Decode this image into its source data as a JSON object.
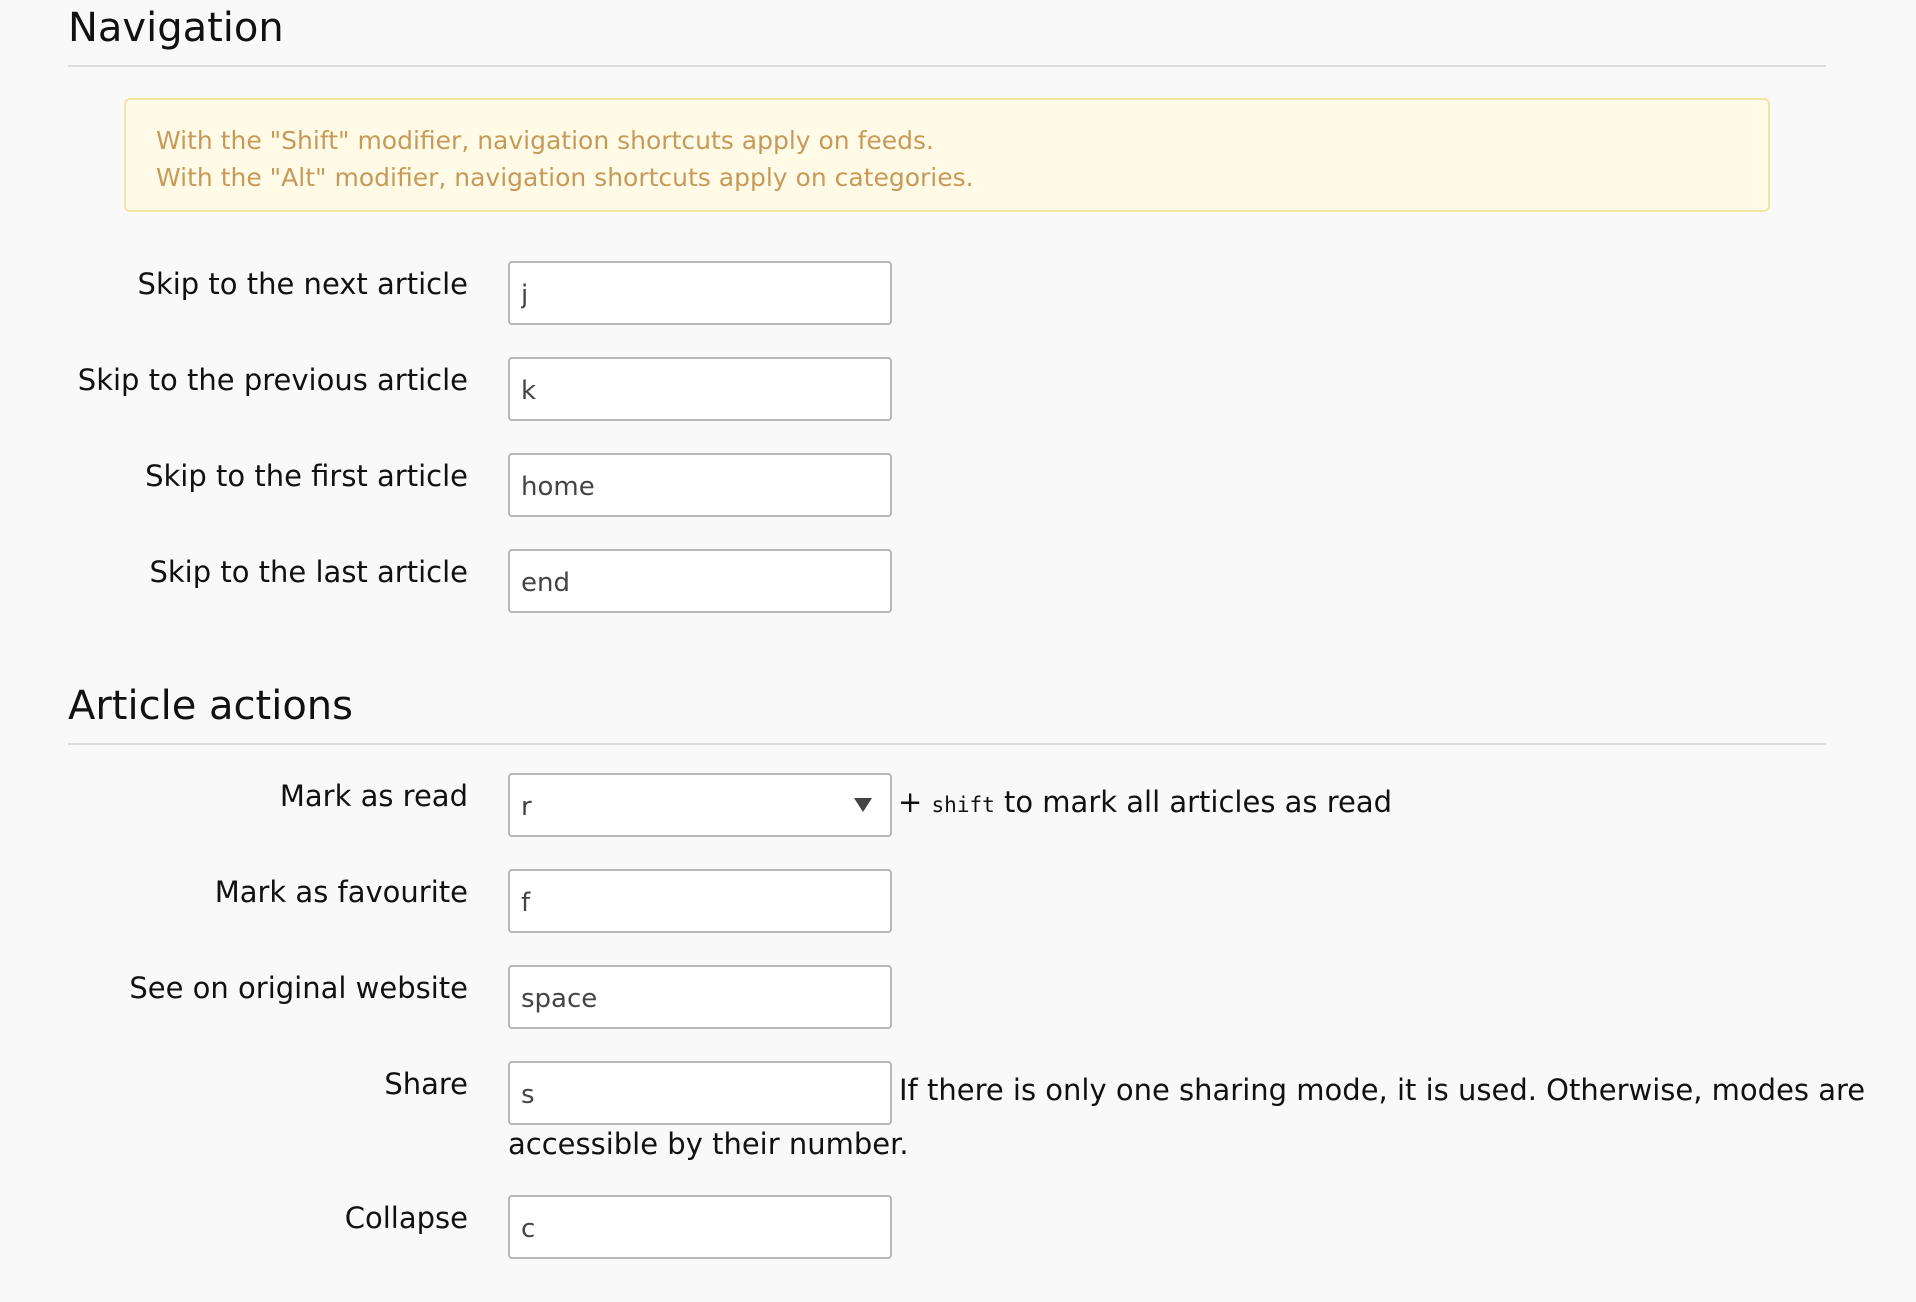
{
  "navigation": {
    "title": "Navigation",
    "alert_lines": [
      "With the \"Shift\" modifier, navigation shortcuts apply on feeds.",
      "With the \"Alt\" modifier, navigation shortcuts apply on categories."
    ],
    "fields": [
      {
        "label": "Skip to the next article",
        "value": "j"
      },
      {
        "label": "Skip to the previous article",
        "value": "k"
      },
      {
        "label": "Skip to the first article",
        "value": "home"
      },
      {
        "label": "Skip to the last article",
        "value": "end"
      }
    ]
  },
  "article_actions": {
    "title": "Article actions",
    "mark_read": {
      "label": "Mark as read",
      "value": "r",
      "note_prefix": "+",
      "note_key": "shift",
      "note_suffix": "to mark all articles as read"
    },
    "mark_favourite": {
      "label": "Mark as favourite",
      "value": "f"
    },
    "see_original": {
      "label": "See on original website",
      "value": "space"
    },
    "share": {
      "label": "Share",
      "value": "s",
      "note_line1": "If there is only one sharing mode, it is used. Otherwise, modes are",
      "note_line2": "accessible by their number."
    },
    "collapse": {
      "label": "Collapse",
      "value": "c"
    }
  }
}
